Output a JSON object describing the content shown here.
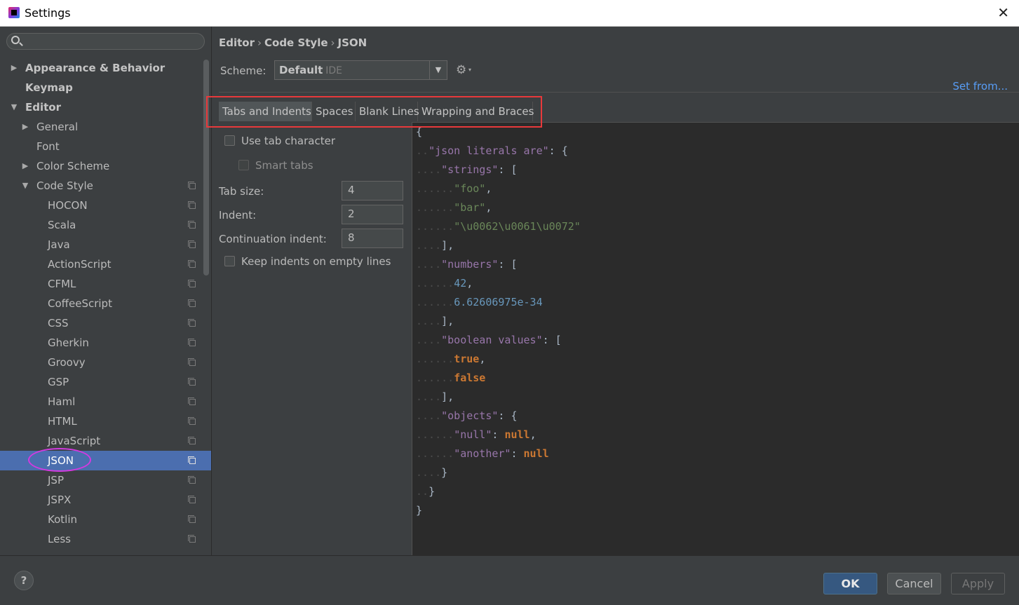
{
  "window": {
    "title": "Settings",
    "close_glyph": "✕"
  },
  "search": {
    "placeholder": ""
  },
  "sidebar": {
    "items": [
      {
        "label": "Appearance & Behavior",
        "arrow": "▶",
        "bold": true
      },
      {
        "label": "Keymap",
        "arrow": "",
        "bold": true
      },
      {
        "label": "Editor",
        "arrow": "▼",
        "bold": true
      },
      {
        "label": "General",
        "arrow": "▶"
      },
      {
        "label": "Font",
        "arrow": ""
      },
      {
        "label": "Color Scheme",
        "arrow": "▶"
      },
      {
        "label": "Code Style",
        "arrow": "▼",
        "copy_icon": true
      },
      {
        "label": "HOCON",
        "copy_icon": true
      },
      {
        "label": "Scala",
        "copy_icon": true
      },
      {
        "label": "Java",
        "copy_icon": true
      },
      {
        "label": "ActionScript",
        "copy_icon": true
      },
      {
        "label": "CFML",
        "copy_icon": true
      },
      {
        "label": "CoffeeScript",
        "copy_icon": true
      },
      {
        "label": "CSS",
        "copy_icon": true
      },
      {
        "label": "Gherkin",
        "copy_icon": true
      },
      {
        "label": "Groovy",
        "copy_icon": true
      },
      {
        "label": "GSP",
        "copy_icon": true
      },
      {
        "label": "Haml",
        "copy_icon": true
      },
      {
        "label": "HTML",
        "copy_icon": true
      },
      {
        "label": "JavaScript",
        "copy_icon": true
      },
      {
        "label": "JSON",
        "copy_icon": true,
        "selected": true
      },
      {
        "label": "JSP",
        "copy_icon": true
      },
      {
        "label": "JSPX",
        "copy_icon": true
      },
      {
        "label": "Kotlin",
        "copy_icon": true
      },
      {
        "label": "Less",
        "copy_icon": true
      }
    ]
  },
  "breadcrumb": {
    "part1": "Editor",
    "part2": "Code Style",
    "part3": "JSON",
    "sep": "›"
  },
  "scheme": {
    "label": "Scheme:",
    "value": "Default",
    "sub": "IDE",
    "dropdown_glyph": "▼"
  },
  "gear": {
    "glyph": "⚙",
    "caret": "▾"
  },
  "set_from": "Set from...",
  "tabs": [
    "Tabs and Indents",
    "Spaces",
    "Blank Lines",
    "Wrapping and Braces"
  ],
  "options": {
    "use_tab": "Use tab character",
    "smart_tabs": "Smart tabs",
    "tab_size_label": "Tab size:",
    "tab_size": "4",
    "indent_label": "Indent:",
    "indent": "2",
    "continuation_label": "Continuation indent:",
    "continuation": "8",
    "keep_indents": "Keep indents on empty lines"
  },
  "code_preview": [
    [
      [
        "pn",
        "{"
      ]
    ],
    [
      [
        "ws",
        ".."
      ],
      [
        "key",
        "\"json literals are\""
      ],
      [
        "pn",
        ": {"
      ]
    ],
    [
      [
        "ws",
        "...."
      ],
      [
        "key",
        "\"strings\""
      ],
      [
        "pn",
        ": ["
      ]
    ],
    [
      [
        "ws",
        "......"
      ],
      [
        "str",
        "\"foo\""
      ],
      [
        "pn",
        ","
      ]
    ],
    [
      [
        "ws",
        "......"
      ],
      [
        "str",
        "\"bar\""
      ],
      [
        "pn",
        ","
      ]
    ],
    [
      [
        "ws",
        "......"
      ],
      [
        "str",
        "\"\\u0062\\u0061\\u0072\""
      ]
    ],
    [
      [
        "ws",
        "...."
      ],
      [
        "pn",
        "],"
      ]
    ],
    [
      [
        "ws",
        "...."
      ],
      [
        "key",
        "\"numbers\""
      ],
      [
        "pn",
        ": ["
      ]
    ],
    [
      [
        "ws",
        "......"
      ],
      [
        "num",
        "42"
      ],
      [
        "pn",
        ","
      ]
    ],
    [
      [
        "ws",
        "......"
      ],
      [
        "num",
        "6.62606975e-34"
      ]
    ],
    [
      [
        "ws",
        "...."
      ],
      [
        "pn",
        "],"
      ]
    ],
    [
      [
        "ws",
        "...."
      ],
      [
        "key",
        "\"boolean values\""
      ],
      [
        "pn",
        ": ["
      ]
    ],
    [
      [
        "ws",
        "......"
      ],
      [
        "kw",
        "true"
      ],
      [
        "pn",
        ","
      ]
    ],
    [
      [
        "ws",
        "......"
      ],
      [
        "kw",
        "false"
      ]
    ],
    [
      [
        "ws",
        "...."
      ],
      [
        "pn",
        "],"
      ]
    ],
    [
      [
        "ws",
        "...."
      ],
      [
        "key",
        "\"objects\""
      ],
      [
        "pn",
        ": {"
      ]
    ],
    [
      [
        "ws",
        "......"
      ],
      [
        "key",
        "\"null\""
      ],
      [
        "pn",
        ": "
      ],
      [
        "kw",
        "null"
      ],
      [
        "pn",
        ","
      ]
    ],
    [
      [
        "ws",
        "......"
      ],
      [
        "key",
        "\"another\""
      ],
      [
        "pn",
        ": "
      ],
      [
        "kw",
        "null"
      ]
    ],
    [
      [
        "ws",
        "...."
      ],
      [
        "pn",
        "}"
      ]
    ],
    [
      [
        "ws",
        ".."
      ],
      [
        "pn",
        "}"
      ]
    ],
    [
      [
        "pn",
        "}"
      ]
    ]
  ],
  "footer": {
    "help": "?",
    "ok": "OK",
    "cancel": "Cancel",
    "apply": "Apply"
  }
}
